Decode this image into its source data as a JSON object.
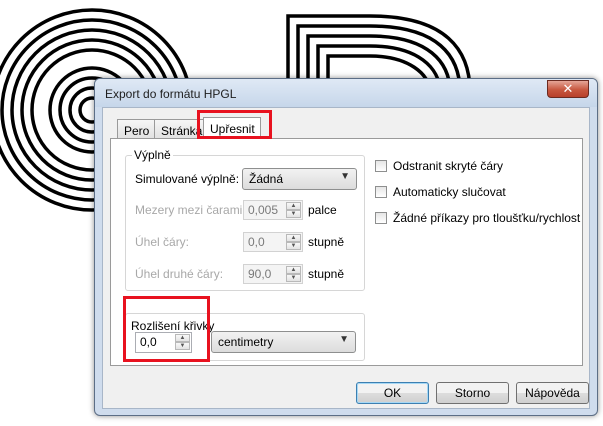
{
  "window": {
    "title": "Export do formátu HPGL",
    "close_glyph": "✕"
  },
  "tabs": [
    {
      "label": "Pero",
      "active": false
    },
    {
      "label": "Stránka",
      "active": false
    },
    {
      "label": "Upřesnit",
      "active": true
    }
  ],
  "fills": {
    "group_label": "Výplně",
    "simulated_label": "Simulované výplně:",
    "simulated_value": "Žádná",
    "line_spacing_label": "Mezery mezi čarami:",
    "line_spacing_value": "0,005",
    "line_spacing_unit": "palce",
    "line_angle_label": "Úhel čáry:",
    "line_angle_value": "0,0",
    "line_angle_unit": "stupně",
    "second_angle_label": "Úhel druhé čáry:",
    "second_angle_value": "90,0",
    "second_angle_unit": "stupně"
  },
  "curve": {
    "label": "Rozlišení křivky",
    "value": "0,0",
    "unit_value": "centimetry"
  },
  "options": [
    {
      "label": "Odstranit skryté čáry",
      "checked": false
    },
    {
      "label": "Automaticky slučovat",
      "checked": false
    },
    {
      "label": "Žádné příkazy pro tloušťku/rychlost",
      "checked": false
    }
  ],
  "buttons": {
    "ok": "OK",
    "cancel": "Storno",
    "help": "Nápověda"
  },
  "icons": {
    "dropdown": "chevron-down-icon",
    "spin_up": "caret-up-icon",
    "spin_down": "caret-down-icon"
  },
  "colors": {
    "highlight": "#e8121f",
    "title_bg": "#cfdced",
    "close": "#c7573f"
  }
}
